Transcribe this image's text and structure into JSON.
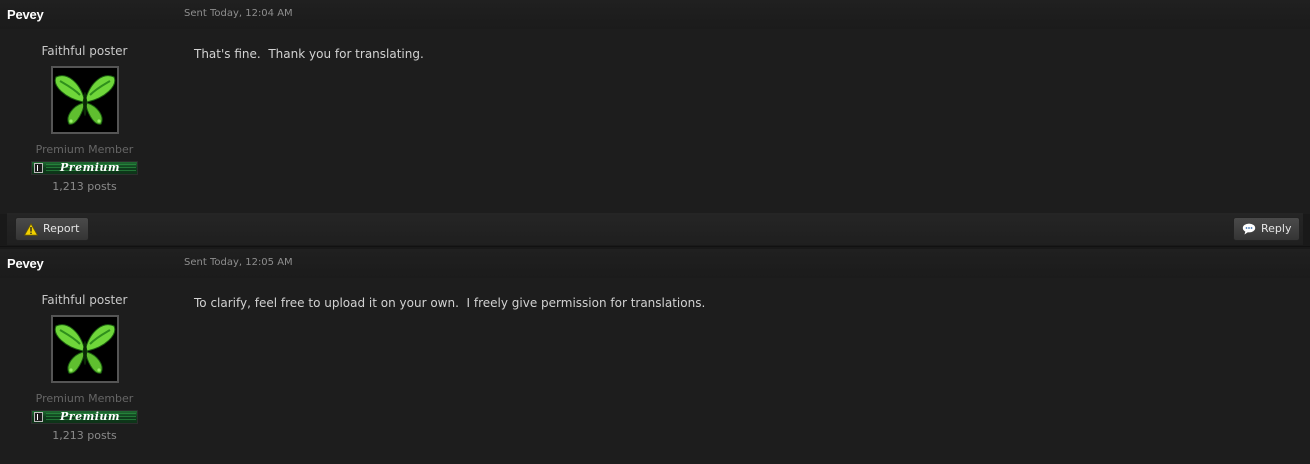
{
  "posts": [
    {
      "author": "Pevey",
      "sent": "Sent Today, 12:04 AM",
      "member_title": "Faithful poster",
      "member_group": "Premium Member",
      "rank_badge_text": "Premium",
      "post_count": "1,213 posts",
      "body": "That's fine.  Thank you for translating.",
      "avatar_icon": "butterfly-icon"
    },
    {
      "author": "Pevey",
      "sent": "Sent Today, 12:05 AM",
      "member_title": "Faithful poster",
      "member_group": "Premium Member",
      "rank_badge_text": "Premium",
      "post_count": "1,213 posts",
      "body": "To clarify, feel free to upload it on your own.  I freely give permission for translations.",
      "avatar_icon": "butterfly-icon"
    }
  ],
  "actions": {
    "report_label": "Report",
    "reply_label": "Reply",
    "report_icon": "warning-icon",
    "reply_icon": "speech-bubble-icon"
  },
  "colors": {
    "background": "#191919",
    "badge_green": "#1f6b32",
    "butterfly_green": "#6fd63a"
  }
}
